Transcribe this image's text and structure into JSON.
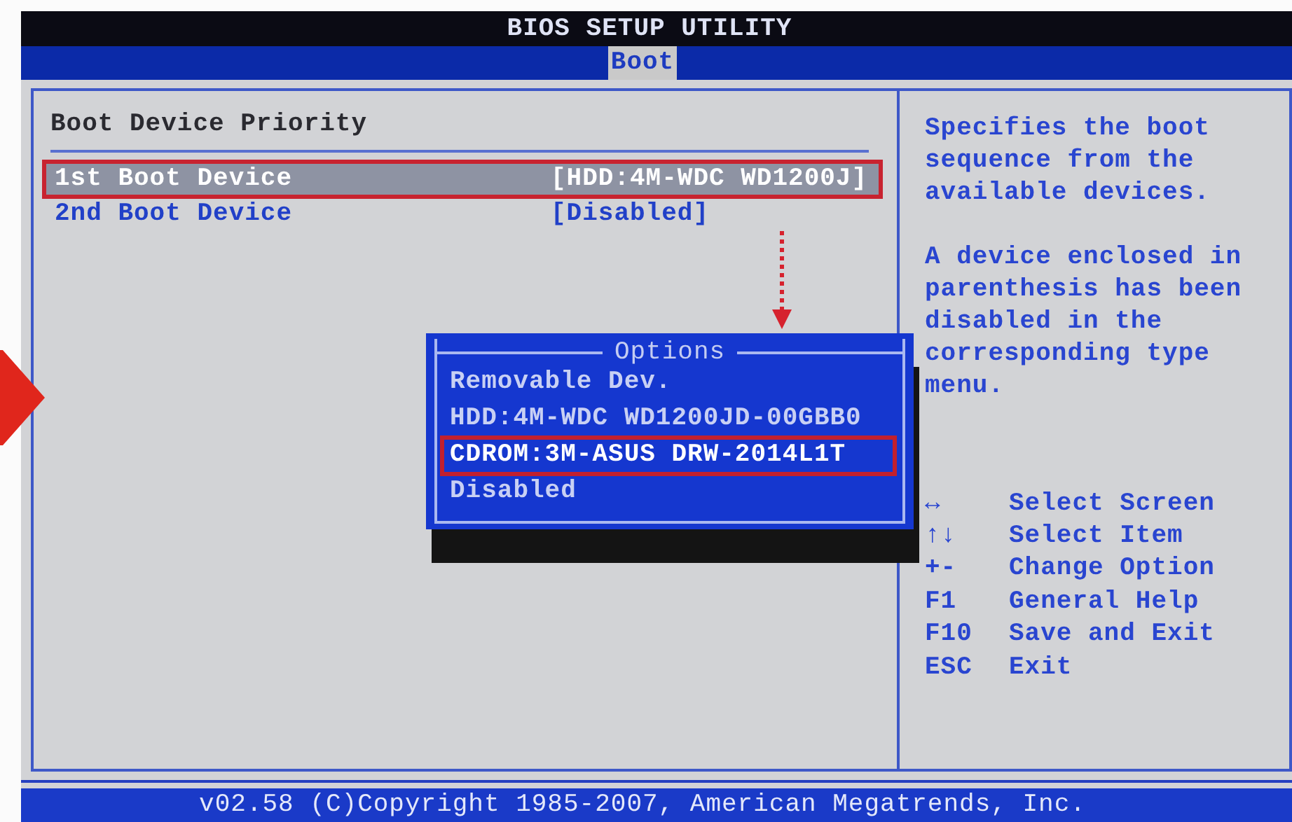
{
  "window": {
    "title": "BIOS SETUP UTILITY"
  },
  "tabs": [
    {
      "label": "Boot",
      "selected": true
    }
  ],
  "section": {
    "title": "Boot Device Priority"
  },
  "settings": [
    {
      "label": "1st Boot Device",
      "value": "[HDD:4M-WDC WD1200J]",
      "selected": true,
      "annotated": true
    },
    {
      "label": "2nd Boot Device",
      "value": "[Disabled]",
      "selected": false,
      "annotated": false
    }
  ],
  "help": [
    "Specifies the boot sequence from the available devices.",
    "A device enclosed in parenthesis has been disabled in the corresponding type menu."
  ],
  "keys": [
    {
      "key": "↔",
      "action": "Select Screen"
    },
    {
      "key": "↑↓",
      "action": "Select Item"
    },
    {
      "key": "+-",
      "action": "Change Option"
    },
    {
      "key": "F1",
      "action": "General Help"
    },
    {
      "key": "F10",
      "action": "Save and Exit"
    },
    {
      "key": "ESC",
      "action": "Exit"
    }
  ],
  "options_popup": {
    "title": "Options",
    "options": [
      {
        "label": "Removable Dev.",
        "selected": false,
        "annotated": false
      },
      {
        "label": "HDD:4M-WDC WD1200JD-00GBB0",
        "selected": false,
        "annotated": false
      },
      {
        "label": "CDROM:3M-ASUS DRW-2014L1T",
        "selected": true,
        "annotated": true
      },
      {
        "label": "Disabled",
        "selected": false,
        "annotated": false
      }
    ]
  },
  "status_bar": {
    "text": "v02.58 (C)Copyright 1985-2007, American Megatrends, Inc."
  }
}
